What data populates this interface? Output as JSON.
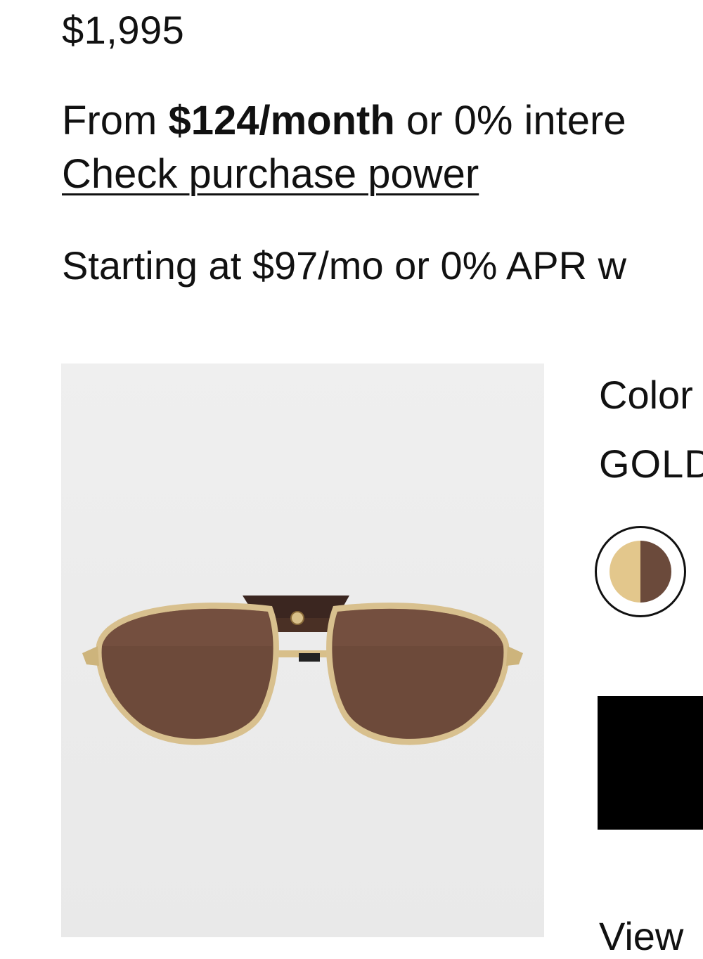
{
  "product": {
    "price": "$1,995"
  },
  "financing": {
    "prefix": "From ",
    "monthly_amount": "$124/month",
    "suffix": " or 0% intere",
    "check_link_label": "Check purchase power"
  },
  "starting_offer": "Starting at $97/mo or 0% APR w",
  "image": {
    "icon": "aviator-sunglasses-product-image"
  },
  "color": {
    "label": "Color",
    "value": "GOLD",
    "swatch": {
      "left_color": "#e3c78c",
      "right_color": "#6b4a3b"
    }
  },
  "add_button_label": "",
  "view_link_label": "View"
}
